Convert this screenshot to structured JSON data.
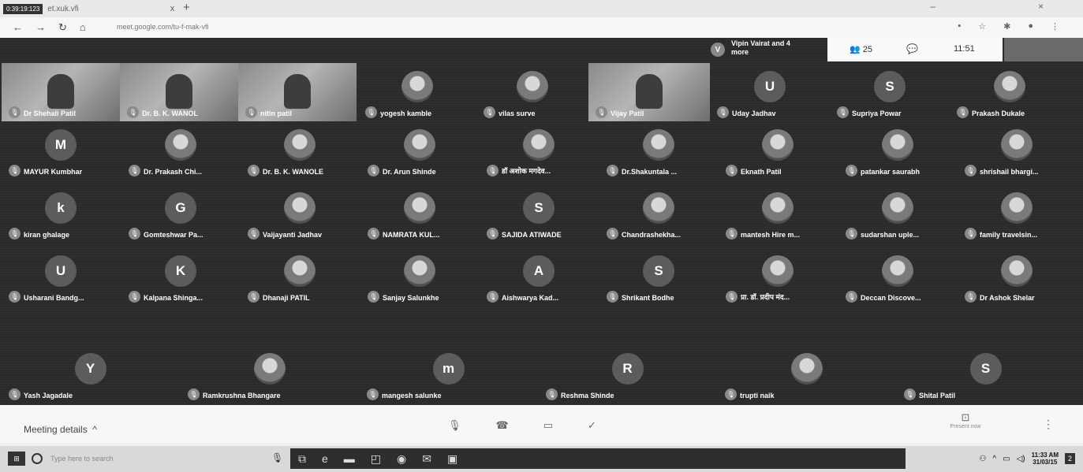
{
  "browser": {
    "tab_badge": "0:39:19:123",
    "tab_title": "et.xuk.vfi",
    "tab_close": "x",
    "new_tab": "+",
    "url": "meet.google.com/tu-f-mak-vfi"
  },
  "meet": {
    "presenting_initial": "V",
    "presenting_name": "Vipin Vairat and 4 more",
    "participant_count": "25",
    "time": "11:51",
    "featured": [
      {
        "name": "Dr Shehali Patil",
        "type": "video"
      },
      {
        "name": "Dr. B. K. WANOL",
        "type": "video"
      },
      {
        "name": "nitin patil",
        "type": "video"
      },
      {
        "name": "yogesh kamble",
        "type": "photo"
      },
      {
        "name": "vilas surve",
        "type": "photo"
      },
      {
        "name": "Vijay Patil",
        "type": "video"
      },
      {
        "name": "Uday Jadhav",
        "type": "letter",
        "initial": "U"
      },
      {
        "name": "Supriya Powar",
        "type": "letter",
        "initial": "S"
      },
      {
        "name": "Prakash Dukale",
        "type": "photo"
      }
    ],
    "rows": [
      [
        {
          "name": "MAYUR Kumbhar",
          "initial": "M"
        },
        {
          "name": "Dr. Prakash Chi...",
          "initial": ""
        },
        {
          "name": "Dr. B. K. WANOLE",
          "initial": ""
        },
        {
          "name": "Dr. Arun Shinde",
          "initial": ""
        },
        {
          "name": "डॉ अशोक मगदेव...",
          "initial": ""
        },
        {
          "name": "Dr.Shakuntala ...",
          "initial": ""
        },
        {
          "name": "Eknath Patil",
          "initial": ""
        },
        {
          "name": "patankar saurabh",
          "initial": ""
        },
        {
          "name": "shrishail bhargi...",
          "initial": ""
        }
      ],
      [
        {
          "name": "kiran ghalage",
          "initial": "k"
        },
        {
          "name": "Gomteshwar Pa...",
          "initial": "G"
        },
        {
          "name": "Vaijayanti Jadhav",
          "initial": ""
        },
        {
          "name": "NAMRATA KUL...",
          "initial": ""
        },
        {
          "name": "SAJIDA ATIWADE",
          "initial": "S"
        },
        {
          "name": "Chandrashekha...",
          "initial": ""
        },
        {
          "name": "mantesh Hire m...",
          "initial": ""
        },
        {
          "name": "sudarshan uple...",
          "initial": ""
        },
        {
          "name": "family travelsin...",
          "initial": ""
        }
      ],
      [
        {
          "name": "Usharani Bandg...",
          "initial": "U"
        },
        {
          "name": "Kalpana Shinga...",
          "initial": "K"
        },
        {
          "name": "Dhanaji PATIL",
          "initial": ""
        },
        {
          "name": "Sanjay Salunkhe",
          "initial": ""
        },
        {
          "name": "Aishwarya Kad...",
          "initial": "A"
        },
        {
          "name": "Shrikant Bodhe",
          "initial": "S"
        },
        {
          "name": "प्रा. डॉ. प्रदीप मंद...",
          "initial": ""
        },
        {
          "name": "Deccan Discove...",
          "initial": ""
        },
        {
          "name": "Dr Ashok Shelar",
          "initial": ""
        }
      ]
    ],
    "last_row": [
      {
        "name": "Yash Jagadale",
        "initial": "Y"
      },
      {
        "name": "Ramkrushna Bhangare",
        "initial": ""
      },
      {
        "name": "mangesh salunke",
        "initial": "m"
      },
      {
        "name": "Reshma Shinde",
        "initial": "R"
      },
      {
        "name": "trupti naik",
        "initial": ""
      },
      {
        "name": "Shital Patil",
        "initial": "S"
      }
    ]
  },
  "bottom": {
    "meeting_details": "Meeting details",
    "present_now": "Present now"
  },
  "taskbar": {
    "search_placeholder": "Type here to search",
    "lang": "ENG",
    "clock_time": "11:33 AM",
    "clock_date": "31/03/15",
    "notif": "2"
  }
}
